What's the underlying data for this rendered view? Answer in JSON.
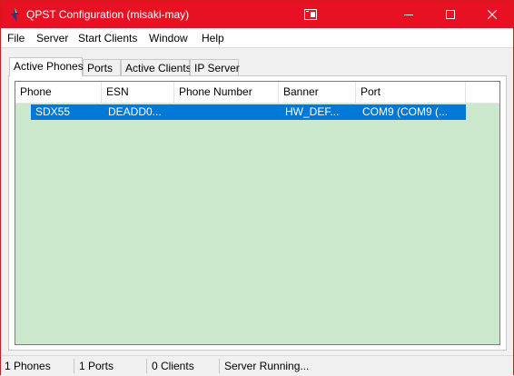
{
  "window": {
    "title": "QPST Configuration (misaki-may)",
    "accent_color": "#e81123",
    "icon": "qpst-app-icon",
    "controls": [
      "restore-icon",
      "minimize-icon",
      "maximize-icon",
      "close-icon"
    ]
  },
  "menu": {
    "items": [
      "File",
      "Server",
      "Start Clients",
      "Window",
      "Help"
    ]
  },
  "tabs": {
    "items": [
      "Active Phones",
      "Ports",
      "Active Clients",
      "IP Server"
    ],
    "selected": "Active Phones"
  },
  "phones_table": {
    "columns": [
      "Phone",
      "ESN",
      "Phone Number",
      "Banner",
      "Port"
    ],
    "rows": [
      {
        "phone": "SDX55",
        "esn": "DEADD0...",
        "phone_number": "",
        "banner": "HW_DEF...",
        "port": "COM9 (COM9 (...",
        "selected": true
      }
    ],
    "background_color": "#cbe8cc",
    "selection_color": "#0078d7"
  },
  "status_bar": {
    "phones": "1 Phones",
    "ports": "1 Ports",
    "clients": "0 Clients",
    "server": "Server Running..."
  }
}
